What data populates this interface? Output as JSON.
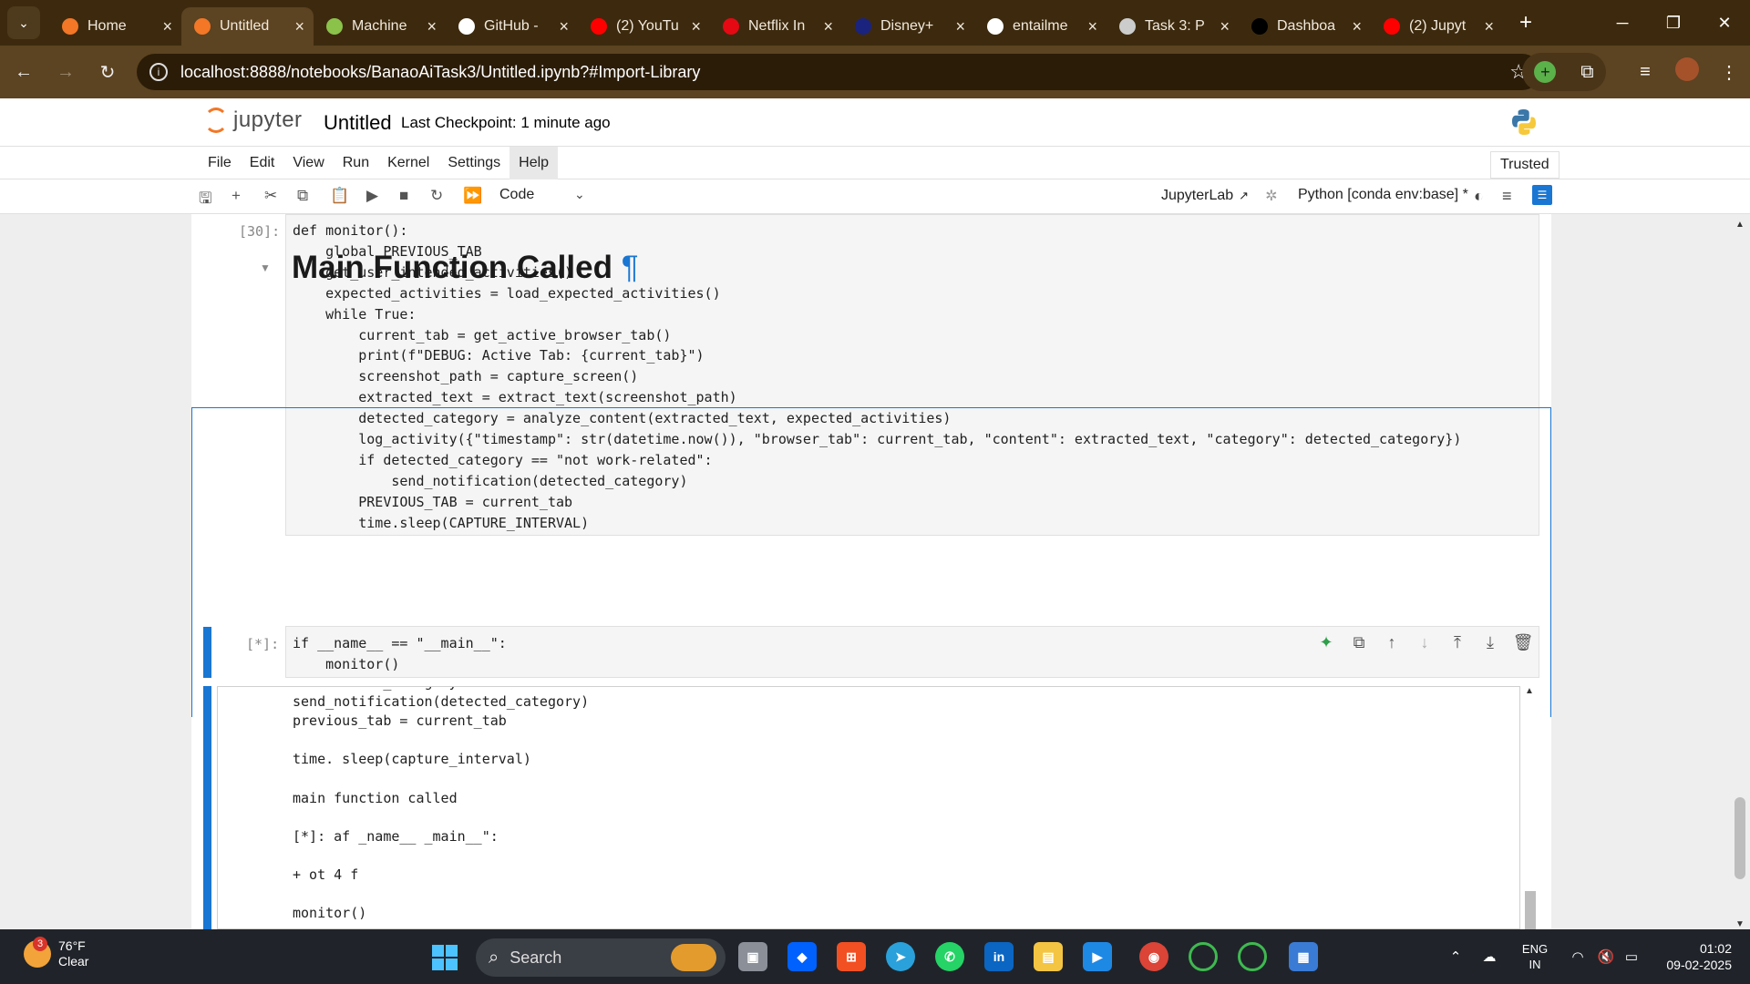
{
  "browser": {
    "menu_icon": "chevron-down-icon",
    "tabs": [
      {
        "title": "Home",
        "icon": "jupyter-icon",
        "color": "#f37726"
      },
      {
        "title": "Untitled",
        "icon": "jupyter-hourglass-icon",
        "color": "#f37726"
      },
      {
        "title": "Machine",
        "icon": "oo-icon",
        "color": "#8bc34a"
      },
      {
        "title": "GitHub -",
        "icon": "github-icon",
        "color": "#ffffff"
      },
      {
        "title": "(2) YouTu",
        "icon": "youtube-icon",
        "color": "#ff0000"
      },
      {
        "title": "Netflix In",
        "icon": "netflix-icon",
        "color": "#e50914"
      },
      {
        "title": "Disney+",
        "icon": "disney-icon",
        "color": "#1a237e"
      },
      {
        "title": "entailme",
        "icon": "google-icon",
        "color": "#ffffff"
      },
      {
        "title": "Task 3: P",
        "icon": "globe-icon",
        "color": "#cccccc"
      },
      {
        "title": "Dashboa",
        "icon": "hotstar-icon",
        "color": "#000000"
      },
      {
        "title": "(2) Jupyt",
        "icon": "youtube-icon",
        "color": "#ff0000"
      }
    ],
    "url": "localhost:8888/notebooks/BanaoAiTask3/Untitled.ipynb?#Import-Library"
  },
  "jupyter": {
    "logo_text": "jupyter",
    "notebook_title": "Untitled",
    "checkpoint": "Last Checkpoint: 1 minute ago",
    "menus": [
      "File",
      "Edit",
      "View",
      "Run",
      "Kernel",
      "Settings",
      "Help"
    ],
    "trusted": "Trusted",
    "cell_type": "Code",
    "jupyterlab_link": "JupyterLab",
    "kernel": "Python [conda env:base] *"
  },
  "cells": {
    "cell1_prompt": "[30]:",
    "cell1_lines": [
      "def monitor():",
      "    global PREVIOUS_TAB",
      "    get_user_intended_activities()",
      "    expected_activities = load_expected_activities()",
      "    while True:",
      "        current_tab = get_active_browser_tab()",
      "        print(f\"DEBUG: Active Tab: {current_tab}\")",
      "        screenshot_path = capture_screen()",
      "        extracted_text = extract_text(screenshot_path)",
      "        detected_category = analyze_content(extracted_text, expected_activities)",
      "        log_activity({\"timestamp\": str(datetime.now()), \"browser_tab\": current_tab, \"content\": extracted_text, \"category\": detected_category})",
      "        if detected_category == \"not work-related\":",
      "            send_notification(detected_category)",
      "        PREVIOUS_TAB = current_tab",
      "        time.sleep(CAPTURE_INTERVAL)"
    ],
    "heading": "Main Function Called",
    "heading_anchor": "¶",
    "cell2_prompt": "[*]:",
    "cell2_lines": [
      "if __name__ == \"__main__\":",
      "    monitor()"
    ],
    "output_lines": [
      "if detected_category == \"not work-related\":",
      "send_notification(detected_category)",
      "previous_tab = current_tab",
      "",
      "time. sleep(capture_interval)",
      "",
      "main function called",
      "",
      "[*]: af _name__ _main__\":",
      "",
      "+ ot 4 f",
      "",
      "monitor()"
    ]
  },
  "taskbar": {
    "weather_badge": "3",
    "temperature": "76°F",
    "condition": "Clear",
    "search_placeholder": "Search",
    "language": "ENG",
    "region": "IN",
    "time": "01:02",
    "date": "09-02-2025"
  }
}
